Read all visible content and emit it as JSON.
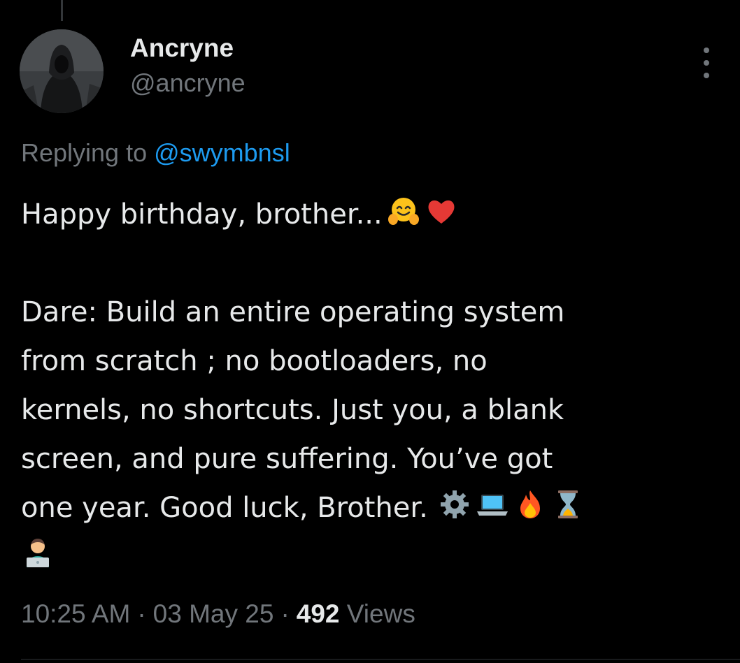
{
  "author": {
    "display_name": "Ancryne",
    "handle": "@ancryne"
  },
  "reply_context": {
    "prefix": "Replying to",
    "mention": "@swymbnsl"
  },
  "tweet": {
    "line1": "Happy birthday, brother...",
    "line1_emojis": [
      "hugging-face-emoji",
      "red-heart-emoji"
    ],
    "dare_lines": [
      "Dare: Build an entire operating system",
      "from scratch ; no bootloaders, no",
      "kernels, no shortcuts. Just you, a blank",
      "screen, and pure suffering. You’ve got",
      "one year. Good luck, Brother."
    ],
    "dare_emojis": [
      "gear-emoji",
      "laptop-emoji",
      "fire-emoji",
      "hourglass-emoji",
      "technologist-emoji"
    ]
  },
  "meta": {
    "time": "10:25 AM",
    "date": "03 May 25",
    "views_count": "492",
    "views_label": "Views",
    "separator": "·"
  },
  "colors": {
    "background": "#000000",
    "text": "#e7e9ea",
    "secondary": "#71767b",
    "accent": "#1d9bf0",
    "divider": "#2f3336"
  }
}
